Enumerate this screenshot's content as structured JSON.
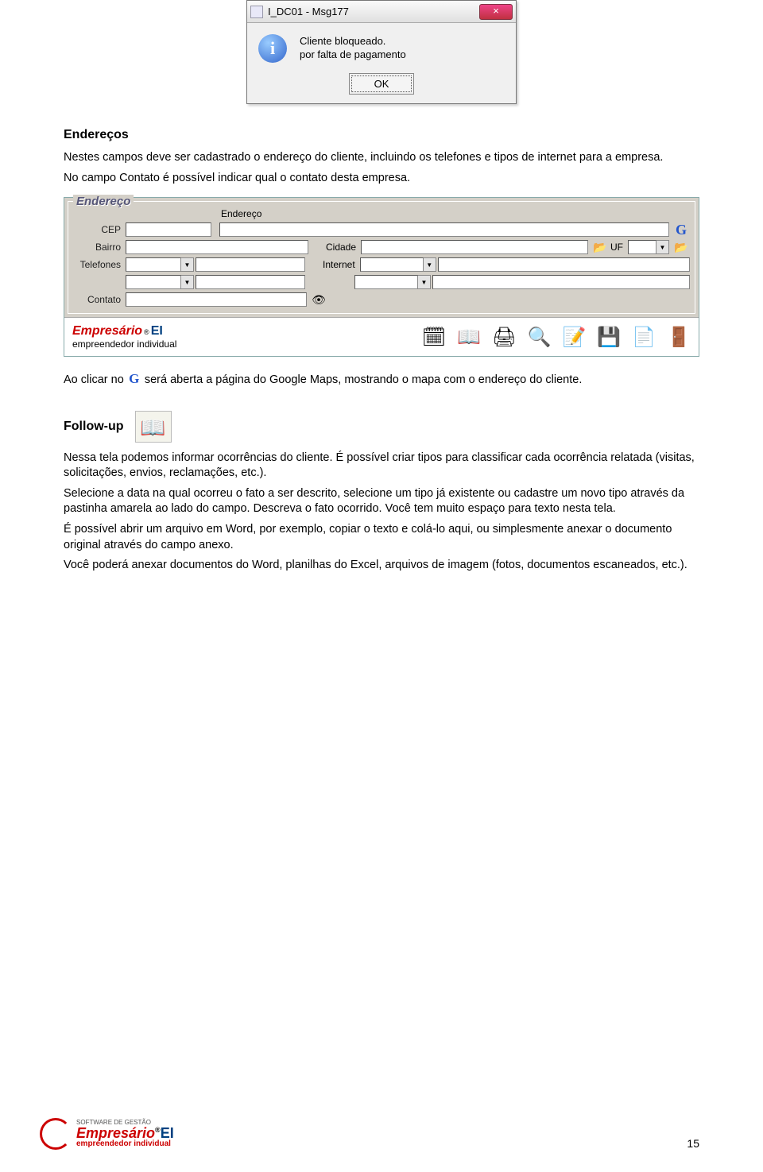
{
  "dialog": {
    "title": "I_DC01 - Msg177",
    "close": "×",
    "info_glyph": "i",
    "message_line1": "Cliente bloqueado.",
    "message_line2": "por falta de pagamento",
    "ok_label": "OK"
  },
  "section1": {
    "heading": "Endereços",
    "p1": "Nestes campos deve ser cadastrado o endereço do cliente, incluindo os telefones e tipos de internet para a empresa.",
    "p2": "No campo Contato é possível indicar qual o contato desta empresa."
  },
  "form": {
    "legend": "Endereço",
    "labels": {
      "cep": "CEP",
      "endereco": "Endereço",
      "bairro": "Bairro",
      "cidade": "Cidade",
      "uf": "UF",
      "telefones": "Telefones",
      "internet": "Internet",
      "contato": "Contato"
    },
    "g_glyph": "G",
    "dd_glyph": "▼",
    "folder_glyph": "📂",
    "eye_glyph": "👁"
  },
  "toolbar": {
    "brand1": "Empresário",
    "brand2": "EI",
    "brand_sub": "empreendedor individual",
    "icons": {
      "calc": "🗓",
      "book": "📖",
      "print": "🖨",
      "search": "🔍",
      "note": "📝",
      "save": "💾",
      "new": "📄",
      "exit": "🚪"
    }
  },
  "para3_pre": "Ao clicar no ",
  "para3_g": "G",
  "para3_post": " será aberta a página do Google Maps, mostrando o mapa com o endereço do cliente.",
  "followup": {
    "heading": "Follow-up",
    "book_glyph": "📖",
    "p1": "Nessa tela podemos informar ocorrências do cliente. É possível criar tipos para classificar cada ocorrência relatada (visitas, solicitações, envios, reclamações, etc.).",
    "p2": "Selecione a data na qual ocorreu o fato a ser descrito, selecione um tipo já existente ou cadastre um novo tipo através da pastinha amarela ao lado do campo. Descreva o fato ocorrido. Você tem muito espaço para texto nesta tela.",
    "p3": "É possível abrir um arquivo em Word, por exemplo, copiar o texto e colá-lo aqui, ou simplesmente anexar o documento original através do campo anexo.",
    "p4": "Você poderá anexar documentos do Word, planilhas do Excel, arquivos de imagem (fotos, documentos escaneados, etc.)."
  },
  "footer": {
    "line1": "SOFTWARE DE GESTÃO",
    "brand1": "Empresário",
    "brand2": "EI",
    "line3": "empreendedor individual",
    "circ": "®"
  },
  "page_number": "15"
}
